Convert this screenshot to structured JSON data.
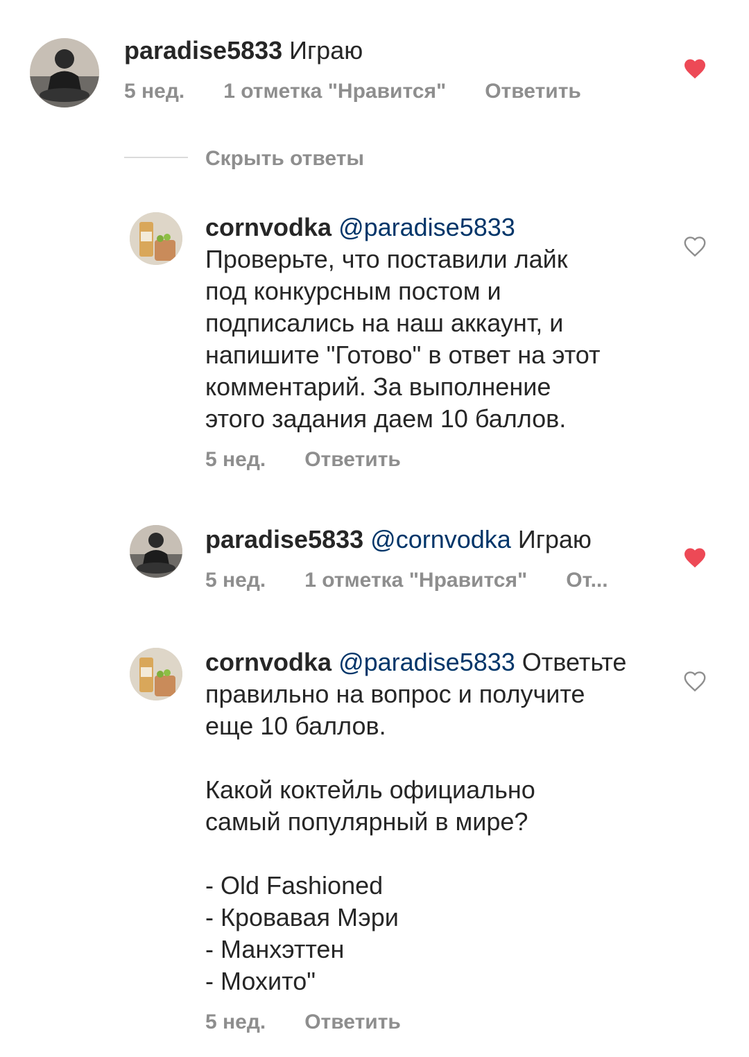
{
  "comments": [
    {
      "user": "paradise5833",
      "mention": "",
      "text": " Играю",
      "time": "5 нед.",
      "likes": "1 отметка \"Нравится\"",
      "reply": "Ответить",
      "liked": true
    },
    {
      "user": "cornvodka",
      "mention": " @paradise5833",
      "text": "\nПроверьте, что поставили лайк\nпод конкурсным постом и\nподписались на наш аккаунт, и\nнапишите \"Готово\" в ответ на этот\nкомментарий. За выполнение\nэтого задания даем 10 баллов.",
      "time": "5 нед.",
      "likes": "",
      "reply": "Ответить",
      "liked": false
    },
    {
      "user": "paradise5833",
      "mention": " @cornvodka",
      "text": " Играю",
      "time": "5 нед.",
      "likes": "1 отметка \"Нравится\"",
      "reply": "От...",
      "liked": true
    },
    {
      "user": "cornvodka",
      "mention": " @paradise5833",
      "text": " Ответьте\nправильно на вопрос и получите\nеще 10 баллов.\n\nКакой коктейль официально\nсамый популярный в мире?\n\n- Old Fashioned\n- Кровавая Мэри\n- Манхэттен\n- Мохито\"",
      "time": "5 нед.",
      "likes": "",
      "reply": "Ответить",
      "liked": false
    }
  ],
  "hide_replies": "Скрыть ответы",
  "colors": {
    "liked": "#ed4956",
    "mention": "#003569",
    "meta": "#8e8e8e"
  }
}
